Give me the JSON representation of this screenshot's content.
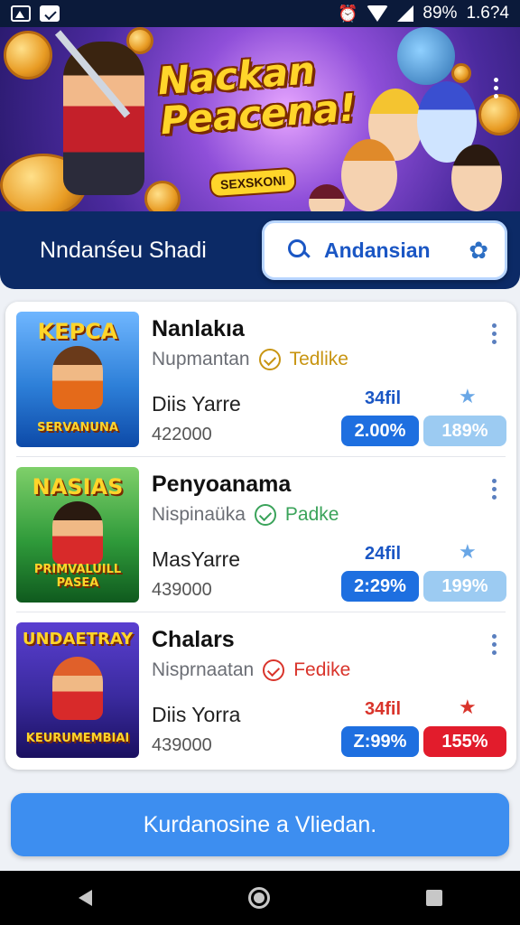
{
  "status_bar": {
    "battery": "89%",
    "time": "1.6?4"
  },
  "hero": {
    "title_line1": "Nackan",
    "title_line2": "Peacena!",
    "badge": "SEXSKONI"
  },
  "header": {
    "title": "Nndanśeu Shadi",
    "search_label": "Andansian"
  },
  "games": [
    {
      "thumb_top": "KEPCA",
      "thumb_bottom": "SERVANUNA",
      "title": "Nanlakıa",
      "subtitle": "Nupmantan",
      "tag": "Tedlike",
      "tag_color": "#c89512",
      "name": "Diis Yarre",
      "count": "422000",
      "label": "34fil",
      "label_color": "#1a56c4",
      "pill_a": "2.00%",
      "pill_b": "189%",
      "pill_a_color": "#1e6fe0",
      "pill_b_color": "#9ccbf2",
      "star_color": "#6aa7e6"
    },
    {
      "thumb_top": "NASIAS",
      "thumb_bottom": "PRIMVALUILL PASEA",
      "title": "Penyoanama",
      "subtitle": "Nispinaüka",
      "tag": "Padke",
      "tag_color": "#3aa35a",
      "name": "MasYarre",
      "count": "439000",
      "label": "24fil",
      "label_color": "#1a56c4",
      "pill_a": "2:29%",
      "pill_b": "199%",
      "pill_a_color": "#1e6fe0",
      "pill_b_color": "#9ccbf2",
      "star_color": "#6aa7e6"
    },
    {
      "thumb_top": "UNDAETRAY",
      "thumb_bottom": "KEURUMEMBIAI",
      "title": "Chalars",
      "subtitle": "Nisprnaatan",
      "tag": "Fedike",
      "tag_color": "#d9342b",
      "name": "Diis Yorra",
      "count": "439000",
      "label": "34fil",
      "label_color": "#d9342b",
      "pill_a": "Z:99%",
      "pill_b": "155%",
      "pill_a_color": "#1e6fe0",
      "pill_b_color": "#e21c2c",
      "star_color": "#d9342b"
    }
  ],
  "cta": {
    "label": "Kurdanosine a Vliedan."
  }
}
